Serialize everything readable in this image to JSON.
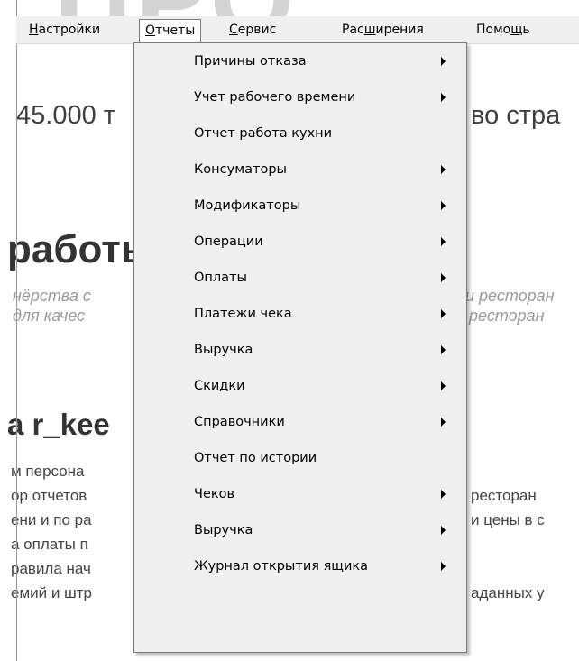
{
  "menubar": {
    "items": [
      {
        "label": "Настройки",
        "mnemonic_index": 0
      },
      {
        "label": "Отчеты",
        "mnemonic_index": 0,
        "active": true
      },
      {
        "label": "Сервис",
        "mnemonic_index": 0
      },
      {
        "label": "Расширения",
        "mnemonic_index": 3
      },
      {
        "label": "Помощь",
        "mnemonic_index": 4
      }
    ]
  },
  "dropdown": {
    "items": [
      {
        "label": "Причины отказа",
        "submenu": true
      },
      {
        "label": "Учет рабочего времени",
        "submenu": true
      },
      {
        "label": "Отчет работа кухни",
        "submenu": false
      },
      {
        "label": "Консуматоры",
        "submenu": true
      },
      {
        "label": "Модификаторы",
        "submenu": true
      },
      {
        "label": "Операции",
        "submenu": true
      },
      {
        "label": "Оплаты",
        "submenu": true
      },
      {
        "label": "Платежи чека",
        "submenu": true
      },
      {
        "label": "Выручка",
        "submenu": true
      },
      {
        "label": "Скидки",
        "submenu": true
      },
      {
        "label": "Справочники",
        "submenu": true
      },
      {
        "label": "Отчет по истории",
        "submenu": false
      },
      {
        "label": "Чеков",
        "submenu": true
      },
      {
        "label": "Выручка",
        "submenu": true
      },
      {
        "label": "Журнал открытия ящика",
        "submenu": true
      }
    ]
  },
  "background": {
    "watermark": "ПРО",
    "line1_left": "45.000 т",
    "line1_right": "во стра",
    "heading_left": "работь",
    "italic1_left": "нёрства с",
    "italic1_right": "и ресторан",
    "italic2_left": "для качес",
    "italic2_right": "ресторан",
    "heading2_left": "а r_kee",
    "body": [
      "м персона",
      "ор отчетов",
      "ени и по ра",
      "а оплаты п",
      "равила нач",
      "емий и штр"
    ],
    "body_right": [
      "ресторан",
      "и цены в с",
      "",
      "аданных у"
    ]
  }
}
